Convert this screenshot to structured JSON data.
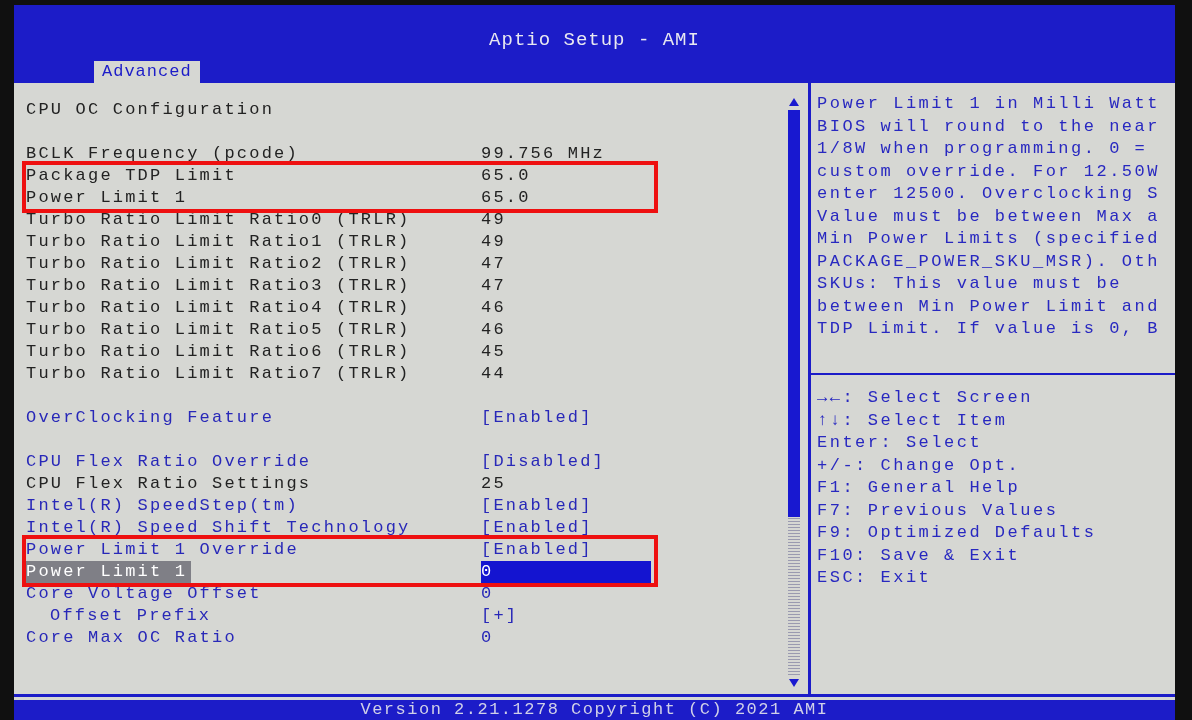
{
  "window": {
    "title": "Aptio Setup - AMI"
  },
  "tabs": [
    {
      "label": "Advanced",
      "selected": true
    }
  ],
  "menu": {
    "title": "CPU OC Configuration",
    "groups": [
      {
        "rows": [
          {
            "label": "BCLK Frequency (pcode)",
            "value": "99.756 MHz",
            "kind": "info",
            "selected": false,
            "marked": false
          },
          {
            "label": "Package TDP Limit",
            "value": "65.0",
            "kind": "info",
            "selected": false,
            "marked": true
          },
          {
            "label": "Power Limit 1",
            "value": "65.0",
            "kind": "info",
            "selected": false,
            "marked": true
          },
          {
            "label": "Turbo Ratio Limit Ratio0 (TRLR)",
            "value": "49",
            "kind": "info",
            "selected": false,
            "marked": false
          },
          {
            "label": "Turbo Ratio Limit Ratio1 (TRLR)",
            "value": "49",
            "kind": "info",
            "selected": false,
            "marked": false
          },
          {
            "label": "Turbo Ratio Limit Ratio2 (TRLR)",
            "value": "47",
            "kind": "info",
            "selected": false,
            "marked": false
          },
          {
            "label": "Turbo Ratio Limit Ratio3 (TRLR)",
            "value": "47",
            "kind": "info",
            "selected": false,
            "marked": false
          },
          {
            "label": "Turbo Ratio Limit Ratio4 (TRLR)",
            "value": "46",
            "kind": "info",
            "selected": false,
            "marked": false
          },
          {
            "label": "Turbo Ratio Limit Ratio5 (TRLR)",
            "value": "46",
            "kind": "info",
            "selected": false,
            "marked": false
          },
          {
            "label": "Turbo Ratio Limit Ratio6 (TRLR)",
            "value": "45",
            "kind": "info",
            "selected": false,
            "marked": false
          },
          {
            "label": "Turbo Ratio Limit Ratio7 (TRLR)",
            "value": "44",
            "kind": "info",
            "selected": false,
            "marked": false
          }
        ]
      },
      {
        "rows": [
          {
            "label": "OverClocking Feature",
            "value": "[Enabled]",
            "kind": "option",
            "selected": false,
            "marked": false
          }
        ]
      },
      {
        "rows": [
          {
            "label": "CPU Flex Ratio Override",
            "value": "[Disabled]",
            "kind": "option",
            "selected": false,
            "marked": false
          },
          {
            "label": "CPU Flex Ratio Settings",
            "value": "25",
            "kind": "info",
            "selected": false,
            "marked": false
          },
          {
            "label": "Intel(R) SpeedStep(tm)",
            "value": "[Enabled]",
            "kind": "option",
            "selected": false,
            "marked": false
          },
          {
            "label": "Intel(R) Speed Shift Technology",
            "value": "[Enabled]",
            "kind": "option",
            "selected": false,
            "marked": false
          },
          {
            "label": "Power Limit 1 Override",
            "value": "[Enabled]",
            "kind": "option",
            "selected": false,
            "marked": true
          },
          {
            "label": "Power Limit 1",
            "value": "0",
            "kind": "option",
            "selected": true,
            "marked": true
          },
          {
            "label": "Core Voltage Offset",
            "value": "0",
            "kind": "option",
            "selected": false,
            "marked": false,
            "children": [
              {
                "label": "Offset Prefix",
                "value": "[+]",
                "kind": "option",
                "selected": false,
                "marked": false
              }
            ]
          },
          {
            "label": "Core Max OC Ratio",
            "value": "0",
            "kind": "option",
            "selected": false,
            "marked": false
          }
        ]
      }
    ]
  },
  "help": [
    "Power Limit 1 in Milli Watt",
    "BIOS will round to the near",
    "1/8W when programming. 0 =",
    "custom override. For 12.50W",
    "enter 12500. Overclocking S",
    "Value must be between Max a",
    "Min Power Limits (specified",
    "PACKAGE_POWER_SKU_MSR). Oth",
    "SKUs: This value must be",
    "between Min Power Limit and",
    "TDP Limit. If value is 0, B"
  ],
  "keys": [
    "→←: Select Screen",
    "↑↓: Select Item",
    "Enter: Select",
    "+/-: Change Opt.",
    "F1: General Help",
    "F7: Previous Values",
    "F9: Optimized Defaults",
    "F10: Save & Exit",
    "ESC: Exit"
  ],
  "status_bar": "Version 2.21.1278 Copyright (C) 2021 AMI"
}
